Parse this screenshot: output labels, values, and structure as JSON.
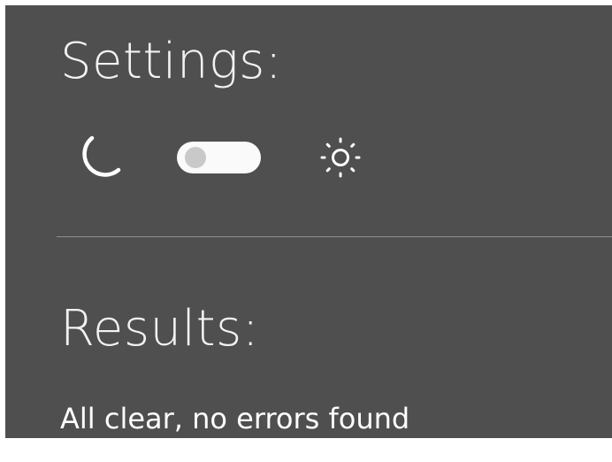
{
  "settings": {
    "title": "Settings:",
    "theme_toggle": {
      "state": "off",
      "left_icon": "moon-icon",
      "right_icon": "sun-icon"
    }
  },
  "results": {
    "title": "Results:",
    "message": "All clear, no errors found"
  },
  "colors": {
    "page_background": "#ffffff",
    "panel_background": "#4f4f4f",
    "text": "#f4f4f4",
    "toggle_track": "#fafafa",
    "toggle_knob": "#c9c9c9",
    "divider": "#8e8e8e"
  }
}
